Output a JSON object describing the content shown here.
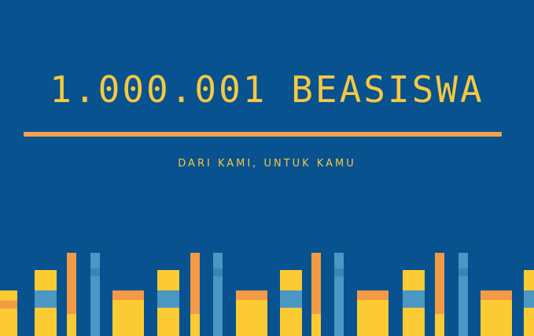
{
  "banner": {
    "title": "1.000.001 BEASISWA",
    "subtitle": "DARI KAMI, UNTUK KAMU"
  },
  "colors": {
    "background": "#07528f",
    "title": "#f5c842",
    "rule": "#f6a14a",
    "book_yellow": "#fcca32",
    "book_orange": "#f39a45",
    "book_blue": "#4a97c4",
    "book_light_blue": "#4d9ccc"
  }
}
